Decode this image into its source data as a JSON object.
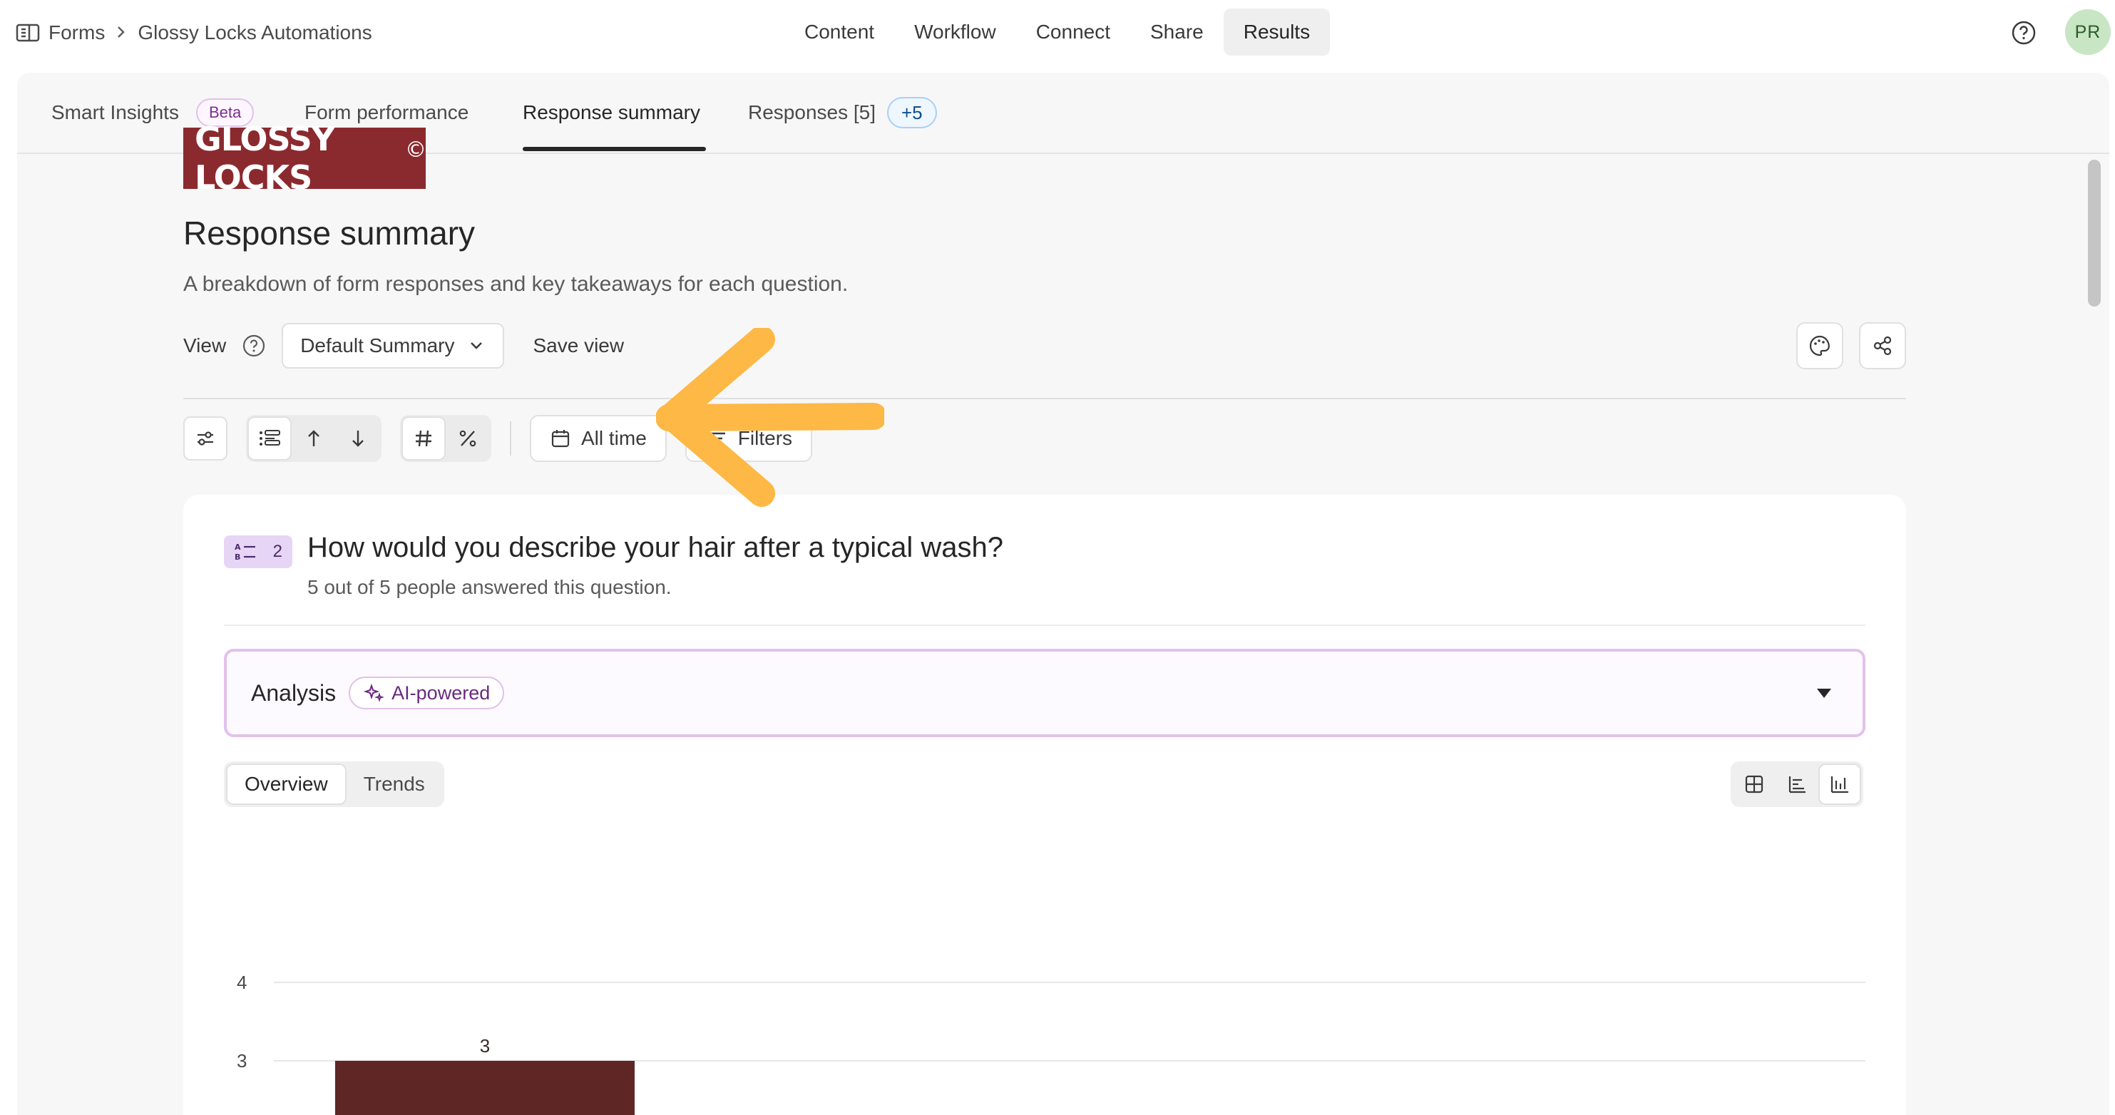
{
  "breadcrumb": {
    "root": "Forms",
    "current": "Glossy Locks Automations"
  },
  "nav": {
    "items": [
      {
        "label": "Content",
        "active": false
      },
      {
        "label": "Workflow",
        "active": false
      },
      {
        "label": "Connect",
        "active": false
      },
      {
        "label": "Share",
        "active": false
      },
      {
        "label": "Results",
        "active": true
      }
    ]
  },
  "user": {
    "initials": "PR"
  },
  "subtabs": {
    "smart_insights": "Smart Insights",
    "beta": "Beta",
    "form_performance": "Form performance",
    "response_summary": "Response summary",
    "responses": "Responses [5]",
    "responses_new": "+5"
  },
  "logo": {
    "text": "GLOSSY LOCKS",
    "mark": "©"
  },
  "page": {
    "title": "Response summary",
    "subtitle": "A breakdown of form responses and key takeaways for each question."
  },
  "view": {
    "label": "View",
    "selected": "Default Summary",
    "save_label": "Save view"
  },
  "toolbar": {
    "date_range": "All time",
    "filters": "Filters"
  },
  "question": {
    "number": "2",
    "title": "How would you describe your hair after a typical wash?",
    "meta": "5 out of 5 people answered this question."
  },
  "analysis": {
    "title": "Analysis",
    "badge": "AI-powered"
  },
  "result_tabs": [
    {
      "label": "Overview",
      "active": true
    },
    {
      "label": "Trends",
      "active": false
    }
  ],
  "chart_types": [
    "table-grid",
    "horizontal-bar",
    "vertical-bar"
  ],
  "chart_data": {
    "type": "bar",
    "categories": [
      ""
    ],
    "values": [
      3
    ],
    "ylim": [
      0,
      4
    ],
    "yticks": [
      4,
      3
    ],
    "grid": true,
    "bar_color": "#5f2626"
  },
  "colors": {
    "accent_purple": "#e2c1ea",
    "bar": "#5f2626",
    "logo_bg": "#8b2a2e",
    "arrow": "#fdb845"
  }
}
